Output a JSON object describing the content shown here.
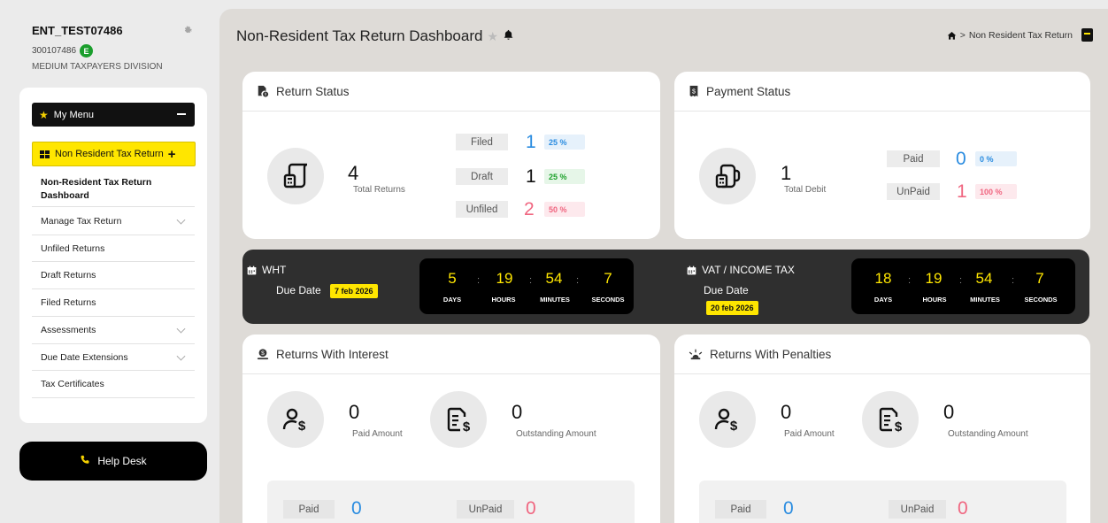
{
  "entity": {
    "name": "ENT_TEST07486",
    "id": "300107486",
    "badge": "E",
    "division": "MEDIUM TAXPAYERS DIVISION"
  },
  "menu": {
    "my_menu": "My Menu",
    "section": "Non Resident Tax Return",
    "items": [
      {
        "label": "Non-Resident Tax Return Dashboard",
        "active": true,
        "expandable": false
      },
      {
        "label": "Manage Tax Return",
        "active": false,
        "expandable": true
      },
      {
        "label": "Unfiled Returns",
        "active": false,
        "expandable": false
      },
      {
        "label": "Draft Returns",
        "active": false,
        "expandable": false
      },
      {
        "label": "Filed Returns",
        "active": false,
        "expandable": false
      },
      {
        "label": "Assessments",
        "active": false,
        "expandable": true
      },
      {
        "label": "Due Date Extensions",
        "active": false,
        "expandable": true
      },
      {
        "label": "Tax Certificates",
        "active": false,
        "expandable": false
      }
    ],
    "help_desk": "Help Desk"
  },
  "header": {
    "title": "Non-Resident Tax Return Dashboard",
    "breadcrumb": "Non Resident Tax Return",
    "breadcrumb_sep": ">"
  },
  "return_status": {
    "title": "Return Status",
    "total": "4",
    "total_label": "Total Returns",
    "rows": [
      {
        "label": "Filed",
        "value": "1",
        "pct": "25 %",
        "color": "blue"
      },
      {
        "label": "Draft",
        "value": "1",
        "pct": "25 %",
        "color": "green"
      },
      {
        "label": "Unfiled",
        "value": "2",
        "pct": "50 %",
        "color": "red"
      }
    ]
  },
  "payment_status": {
    "title": "Payment Status",
    "total": "1",
    "total_label": "Total Debit",
    "rows": [
      {
        "label": "Paid",
        "value": "0",
        "pct": "0 %",
        "color": "blue"
      },
      {
        "label": "UnPaid",
        "value": "1",
        "pct": "100 %",
        "color": "red"
      }
    ]
  },
  "due_dates": {
    "wht": {
      "label": "WHT",
      "due_label": "Due Date",
      "date": "7 feb 2026",
      "days": "5",
      "hours": "19",
      "minutes": "54",
      "seconds": "7"
    },
    "vat": {
      "label": "VAT / INCOME TAX",
      "due_label": "Due Date",
      "date": "20 feb 2026",
      "days": "18",
      "hours": "19",
      "minutes": "54",
      "seconds": "7"
    },
    "unit_labels": {
      "days": "DAYS",
      "hours": "HOURS",
      "minutes": "MINUTES",
      "seconds": "SECONDS"
    },
    "separator": ":"
  },
  "returns_interest": {
    "title": "Returns With Interest",
    "paid_amount": "0",
    "paid_amount_label": "Paid Amount",
    "outstanding_amount": "0",
    "outstanding_amount_label": "Outstanding Amount",
    "paid_label": "Paid",
    "paid_value": "0",
    "unpaid_label": "UnPaid",
    "unpaid_value": "0"
  },
  "returns_penalties": {
    "title": "Returns With Penalties",
    "paid_amount": "0",
    "paid_amount_label": "Paid Amount",
    "outstanding_amount": "0",
    "outstanding_amount_label": "Outstanding Amount",
    "paid_label": "Paid",
    "paid_value": "0",
    "unpaid_label": "UnPaid",
    "unpaid_value": "0"
  },
  "colors": {
    "accent_yellow": "#ffe600",
    "blue": "#2a8ce0",
    "green": "#1ea12b",
    "red": "#f06680",
    "band_bg": "#2f2f2f"
  }
}
